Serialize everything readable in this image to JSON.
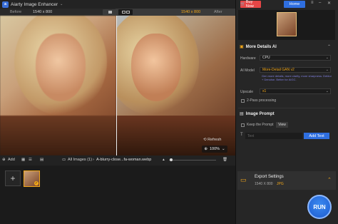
{
  "app": {
    "title": "Aiarty Image Enhancer"
  },
  "compare": {
    "before_label": "Before",
    "before_res": "1540 x 800",
    "after_res": "1540 x 800",
    "after_label": "After"
  },
  "preview": {
    "refresh_label": "Refresh",
    "zoom": "100%"
  },
  "bottombar": {
    "add_label": "Add",
    "all_images": "All Images (1)",
    "filename": "A-blurry-close...fa-woman.webp"
  },
  "topright": {
    "buy_now": "Buy Now",
    "home": "Home"
  },
  "more_details": {
    "section_title": "More Details AI",
    "hardware_label": "Hardware",
    "hardware_value": "CPU",
    "ai_model_label": "AI Model",
    "ai_model_value": "More-Detail GAN v2",
    "ai_model_desc": "Gen more details, more clarity, more sharpness. Deblur + Denoise. Better for AIGC.",
    "upscale_label": "Upscale",
    "upscale_value": "x1",
    "two_pass_label": "2-Pass processing"
  },
  "image_prompt": {
    "section_title": "Image Prompt",
    "keep_prompt_label": "Keep the Prompt",
    "view_label": "View",
    "text_placeholder": "Text",
    "add_text_label": "Add Text"
  },
  "export": {
    "title": "Export Settings",
    "resolution": "1540 X 800",
    "format": "JPG"
  },
  "run": {
    "label": "RUN"
  },
  "colors": {
    "accent": "#f3a81a",
    "primary": "#2f6fe0",
    "buy": "#e64646"
  }
}
